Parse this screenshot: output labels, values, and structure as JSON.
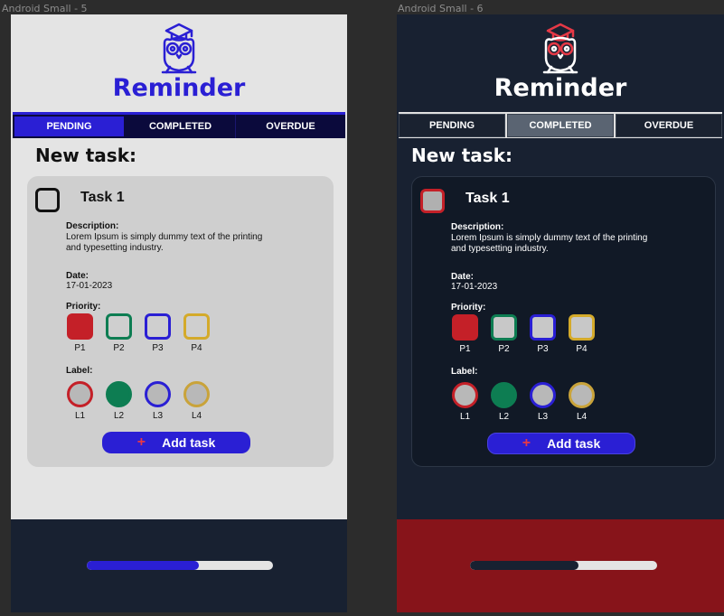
{
  "frames": [
    {
      "id": "light",
      "frame_label": "Android Small - 5",
      "app_title": "Reminder",
      "tabs": [
        {
          "label": "PENDING"
        },
        {
          "label": "COMPLETED"
        },
        {
          "label": "OVERDUE"
        }
      ],
      "active_tab": "PENDING",
      "heading": "New task:",
      "task": {
        "title": "Task 1",
        "description_label": "Description:",
        "description_value": "Lorem Ipsum is simply dummy text of the printing and typesetting industry.",
        "date_label": "Date:",
        "date_value": "17-01-2023",
        "priority_label": "Priority:",
        "priorities": [
          {
            "label": "P1",
            "border": "#c42028",
            "fill": "#c42028"
          },
          {
            "label": "P2",
            "border": "#0d7d52",
            "fill": "transparent"
          },
          {
            "label": "P3",
            "border": "#2a1fd4",
            "fill": "transparent"
          },
          {
            "label": "P4",
            "border": "#d4aa2a",
            "fill": "transparent"
          }
        ],
        "label_label": "Label:",
        "labels": [
          {
            "label": "L1",
            "border": "#c42028",
            "fill": "#b8b8b8"
          },
          {
            "label": "L2",
            "border": "#0d7d52",
            "fill": "#0d7d52"
          },
          {
            "label": "L3",
            "border": "#2a1fd4",
            "fill": "#b8b8b8"
          },
          {
            "label": "L4",
            "border": "#c9a33a",
            "fill": "#b8b8b8"
          }
        ],
        "add_button_icon": "+",
        "add_button_label": "Add task"
      },
      "progress": 0.6
    },
    {
      "id": "dark",
      "frame_label": "Android Small - 6",
      "app_title": "Reminder",
      "tabs": [
        {
          "label": "PENDING"
        },
        {
          "label": "COMPLETED"
        },
        {
          "label": "OVERDUE"
        }
      ],
      "active_tab": "COMPLETED",
      "heading": "New task:",
      "task": {
        "title": "Task 1",
        "description_label": "Description:",
        "description_value": "Lorem Ipsum is simply dummy text of the printing and typesetting industry.",
        "date_label": "Date:",
        "date_value": "17-01-2023",
        "priority_label": "Priority:",
        "priorities": [
          {
            "label": "P1",
            "border": "#c42028",
            "fill": "#c42028"
          },
          {
            "label": "P2",
            "border": "#0d7d52",
            "fill": "#c8c8c8"
          },
          {
            "label": "P3",
            "border": "#2a1fd4",
            "fill": "#c8c8c8"
          },
          {
            "label": "P4",
            "border": "#d4aa2a",
            "fill": "#c8c8c8"
          }
        ],
        "label_label": "Label:",
        "labels": [
          {
            "label": "L1",
            "border": "#c42028",
            "fill": "#b8b8b8"
          },
          {
            "label": "L2",
            "border": "#0d7d52",
            "fill": "#0d7d52"
          },
          {
            "label": "L3",
            "border": "#2a1fd4",
            "fill": "#b8b8b8"
          },
          {
            "label": "L4",
            "border": "#c9a33a",
            "fill": "#b8b8b8"
          }
        ],
        "add_button_icon": "+",
        "add_button_label": "Add task"
      },
      "progress": 0.58
    }
  ],
  "colors": {
    "brand_blue": "#2a1fd4",
    "dark_navy": "#182131",
    "danger_red": "#c42028",
    "success_green": "#0d7d52",
    "warning_yellow": "#d4aa2a"
  },
  "icons": {
    "logo": "owl-graduate-icon"
  }
}
